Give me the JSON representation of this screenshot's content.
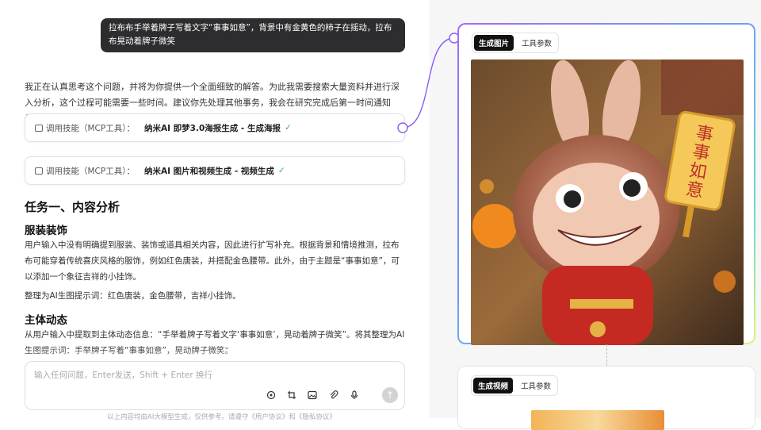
{
  "user_message": "拉布布手举着牌子写着文字“事事如意”，背景中有金黄色的柿子在摇动，拉布布晃动着牌子微笑",
  "intro": "我正在认真思考这个问题，并将为你提供一个全面细致的解答。为此我需要搜索大量资料并进行深入分析，这个过程可能需要一些时间。建议你先处理其他事务，我会在研究完成后第一时间通知你。",
  "tools": [
    {
      "prefix": "调用技能（MCP工具）：",
      "name": "纳米AI 即梦3.0海报生成 - 生成海报",
      "status": "✓"
    },
    {
      "prefix": "调用技能（MCP工具）：",
      "name": "纳米AI 图片和视频生成 - 视频生成",
      "status": "✓"
    }
  ],
  "task_title": "任务一、内容分析",
  "section1": {
    "title": "服装装饰",
    "p1": "用户输入中没有明确提到服装、装饰或道具相关内容，因此进行扩写补充。根据背景和情境推测，拉布布可能穿着传统喜庆风格的服饰，例如红色唐装，并搭配金色腰带。此外，由于主题是“事事如意”，可以添加一个象征吉祥的小挂饰。",
    "p2": "整理为AI生图提示词：红色唐装，金色腰带，吉祥小挂饰。"
  },
  "section2": {
    "title": "主体动态",
    "p1": "从用户输入中提取到主体动态信息：“手举着牌子写着文字‘事事如意’，晃动着牌子微笑”。将其整理为AI生图提示词：手举牌子写着“事事如意”，晃动牌子微笑。"
  },
  "input": {
    "placeholder": "输入任何问题，Enter发送，Shift + Enter 换行",
    "send_icon": "arrow-up"
  },
  "footer": "以上内容均由AI大模型生成，仅供参考。请遵守《用户协议》和《隐私协议》",
  "card1": {
    "tab_active": "生成图片",
    "tab_other": "工具参数",
    "sign_text": "事事如意"
  },
  "card2": {
    "tab_active": "生成视频",
    "tab_other": "工具参数"
  },
  "colors": {
    "accent": "#8b5cf6",
    "check": "#35b06b",
    "bubble": "#2d2d2f"
  }
}
